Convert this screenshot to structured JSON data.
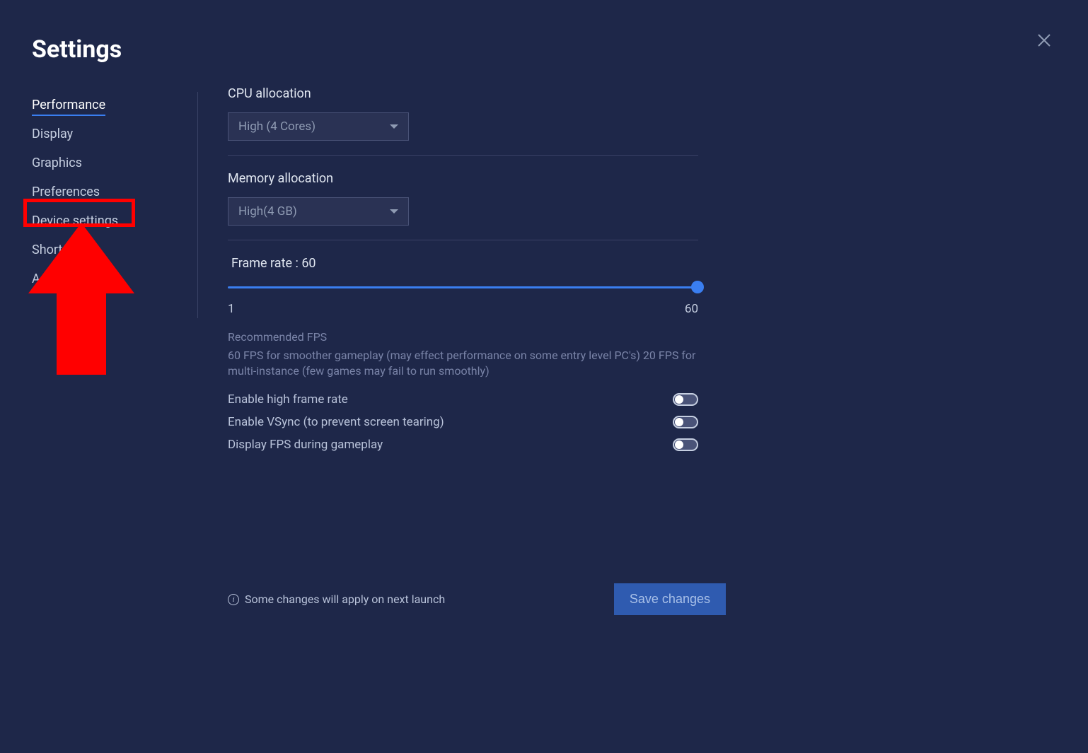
{
  "title": "Settings",
  "sidebar": {
    "items": [
      {
        "label": "Performance",
        "active": true
      },
      {
        "label": "Display",
        "active": false
      },
      {
        "label": "Graphics",
        "active": false
      },
      {
        "label": "Preferences",
        "active": false
      },
      {
        "label": "Device settings",
        "active": false
      },
      {
        "label": "Shortcuts",
        "active": false
      },
      {
        "label": "Advanced",
        "active": false
      }
    ]
  },
  "cpu": {
    "label": "CPU allocation",
    "value": "High (4 Cores)"
  },
  "memory": {
    "label": "Memory allocation",
    "value": "High(4 GB)"
  },
  "framerate": {
    "label": "Frame rate : 60",
    "min": "1",
    "max": "60"
  },
  "fps": {
    "heading": "Recommended FPS",
    "description": "60 FPS for smoother gameplay (may effect performance on some entry level PC's) 20 FPS for multi-instance (few games may fail to run smoothly)"
  },
  "toggles": {
    "high_frame_rate": "Enable high frame rate",
    "vsync": "Enable VSync (to prevent screen tearing)",
    "display_fps": "Display FPS during gameplay"
  },
  "footer": {
    "notice": "Some changes will apply on next launch",
    "save_button": "Save changes"
  },
  "annotation": {
    "highlight_target": "Device settings",
    "arrow_direction": "up"
  }
}
